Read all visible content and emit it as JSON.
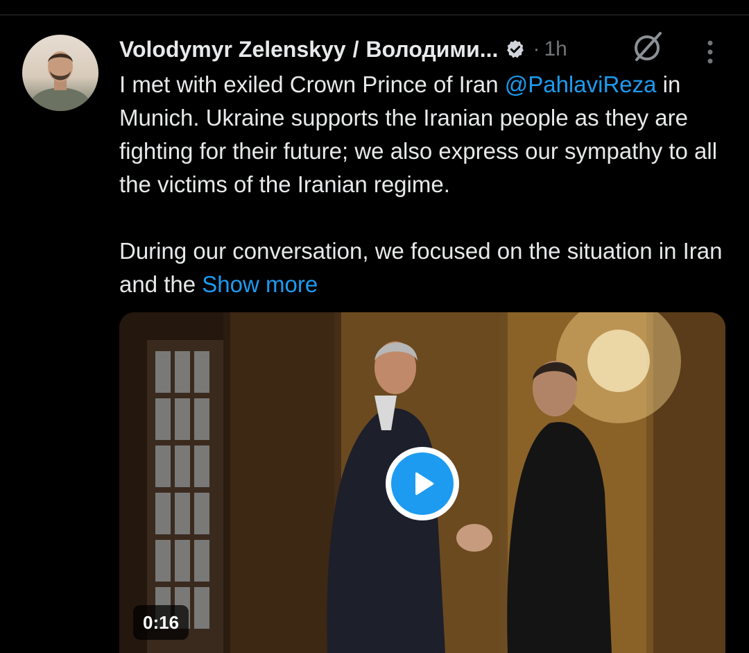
{
  "tweet": {
    "author_name": "Volodymyr Zelenskyy",
    "separator": "/",
    "author_alt_name": "Володими...",
    "dot": "·",
    "time": "1h",
    "text_line_1": "I met with exiled Crown Prince of Iran ",
    "mention": "@PahlaviReza",
    "text_line_1_tail": " in Munich. Ukraine supports the Iranian people as they are fighting for their future; we also express our sympathy to all the victims of the Iranian regime.",
    "text_para_2": "During our conversation, we focused on the situation in Iran and the ",
    "show_more": "Show more"
  },
  "media": {
    "duration": "0:16"
  },
  "icons": {
    "verified": "verified-badge-icon",
    "grok": "grok-icon",
    "more": "more-vertical-icon",
    "play": "play-icon"
  },
  "colors": {
    "background": "#000000",
    "text": "#e7e9ea",
    "secondary": "#71767b",
    "accent": "#1d9bf0"
  }
}
